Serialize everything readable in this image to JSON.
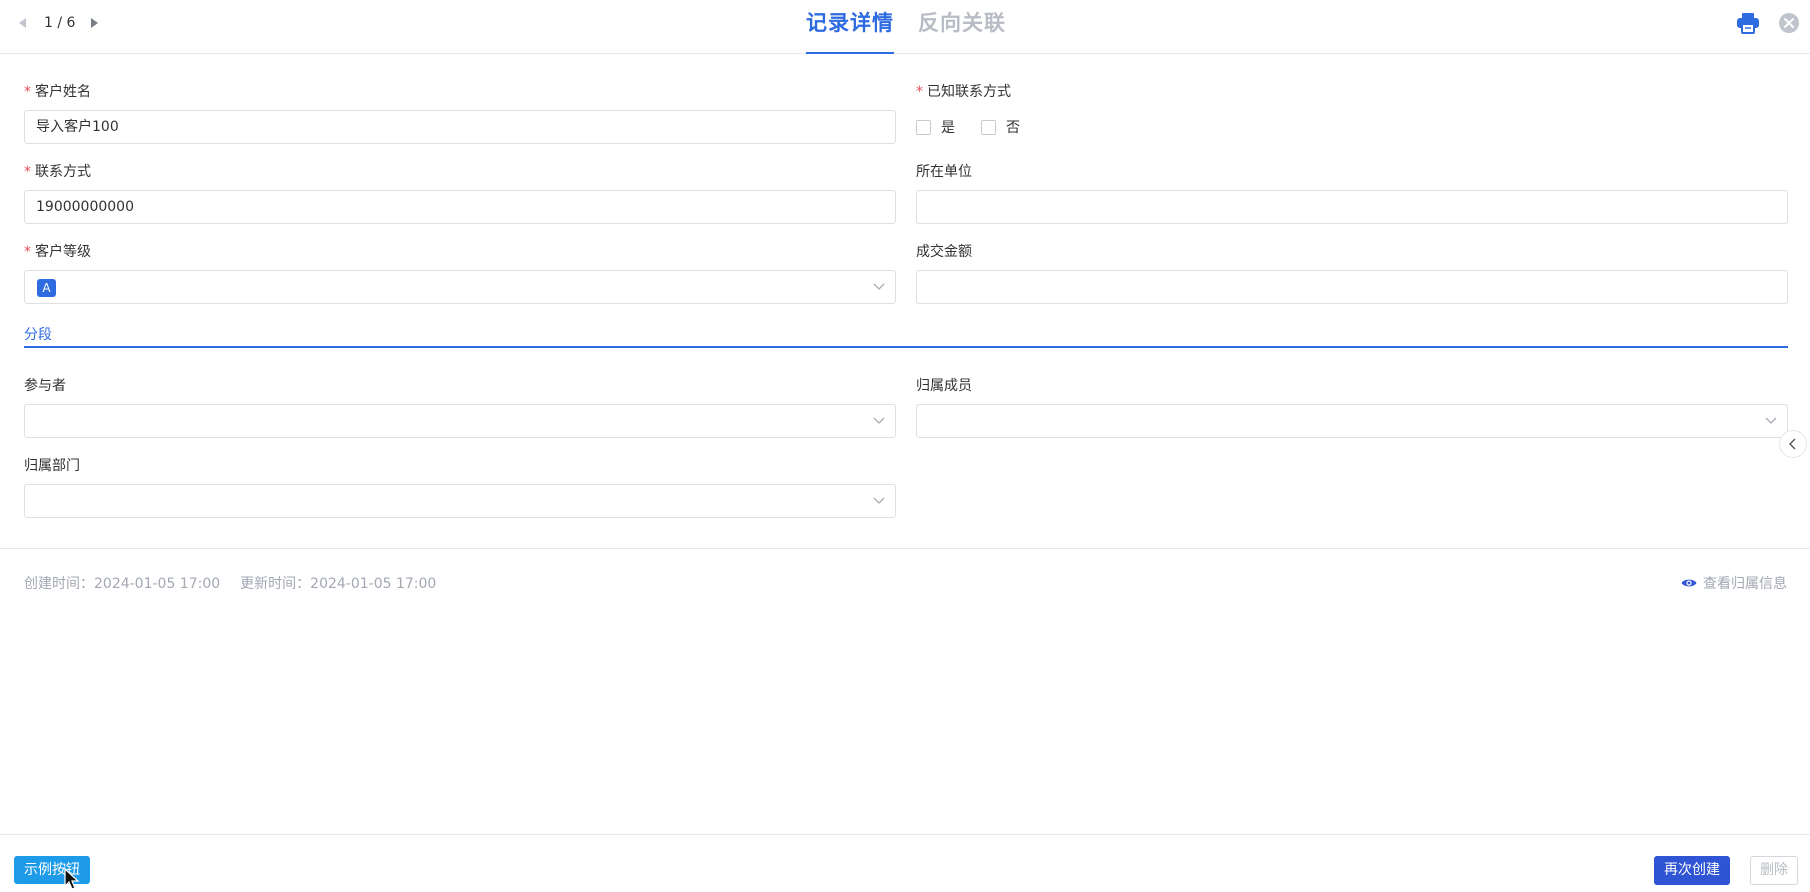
{
  "header": {
    "pager": {
      "current": "1 / 6"
    },
    "tabs": [
      {
        "label": "记录详情",
        "active": true
      },
      {
        "label": "反向关联",
        "active": false
      }
    ],
    "accent_color": "#2f6be0"
  },
  "form": {
    "customer_name": {
      "label": "客户姓名",
      "required": true,
      "value": "导入客户100"
    },
    "known_contact": {
      "label": "已知联系方式",
      "required": true,
      "options": [
        "是",
        "否"
      ]
    },
    "contact": {
      "label": "联系方式",
      "required": true,
      "value": "19000000000"
    },
    "company": {
      "label": "所在单位",
      "required": false,
      "value": ""
    },
    "customer_level": {
      "label": "客户等级",
      "required": true,
      "value": "A"
    },
    "deal_amount": {
      "label": "成交金额",
      "required": false,
      "value": ""
    },
    "section": {
      "title": "分段"
    },
    "participants": {
      "label": "参与者",
      "value": ""
    },
    "owner_member": {
      "label": "归属成员",
      "value": ""
    },
    "owner_department": {
      "label": "归属部门",
      "value": ""
    }
  },
  "meta": {
    "created": "创建时间：2024-01-05 17:00",
    "updated": "更新时间：2024-01-05 17:00",
    "view_owner": "查看归属信息"
  },
  "footer": {
    "example_button": "示例按钮",
    "recreate_button": "再次创建",
    "delete_button": "删除"
  }
}
